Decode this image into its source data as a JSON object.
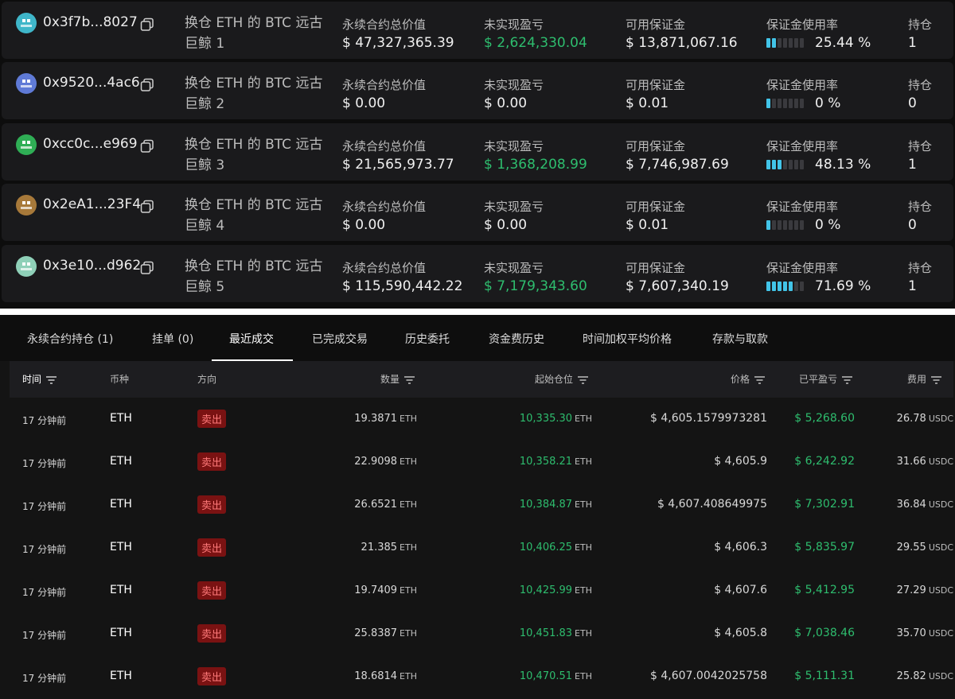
{
  "labels": {
    "perp_value": "永续合约总价值",
    "unrealized_pnl": "未实现盈亏",
    "available_margin": "可用保证金",
    "margin_usage": "保证金使用率",
    "positions": "持仓"
  },
  "wallets": [
    {
      "address": "0x3f7b...8027",
      "tag_line1": "换仓 ETH 的 BTC 远古",
      "tag_line2": "巨鲸 1",
      "perp_value": "$ 47,327,365.39",
      "unrealized_pnl": "$ 2,624,330.04",
      "pnl_positive": true,
      "available_margin": "$ 13,871,067.16",
      "margin_usage": "25.44 %",
      "margin_usage_fraction": 0.2544,
      "positions": "1",
      "avatar_color": "#3fb6c9"
    },
    {
      "address": "0x9520...4ac6",
      "tag_line1": "换仓 ETH 的 BTC 远古",
      "tag_line2": "巨鲸 2",
      "perp_value": "$ 0.00",
      "unrealized_pnl": "$ 0.00",
      "pnl_positive": false,
      "available_margin": "$ 0.01",
      "margin_usage": "0 %",
      "margin_usage_fraction": 0,
      "positions": "0",
      "avatar_color": "#5f7ad6"
    },
    {
      "address": "0xcc0c...e969",
      "tag_line1": "换仓 ETH 的 BTC 远古",
      "tag_line2": "巨鲸 3",
      "perp_value": "$ 21,565,973.77",
      "unrealized_pnl": "$ 1,368,208.99",
      "pnl_positive": true,
      "available_margin": "$ 7,746,987.69",
      "margin_usage": "48.13 %",
      "margin_usage_fraction": 0.4813,
      "positions": "1",
      "avatar_color": "#2fae55"
    },
    {
      "address": "0x2eA1...23F4",
      "tag_line1": "换仓 ETH 的 BTC 远古",
      "tag_line2": "巨鲸 4",
      "perp_value": "$ 0.00",
      "unrealized_pnl": "$ 0.00",
      "pnl_positive": false,
      "available_margin": "$ 0.01",
      "margin_usage": "0 %",
      "margin_usage_fraction": 0,
      "positions": "0",
      "avatar_color": "#a7793a"
    },
    {
      "address": "0x3e10...d962",
      "tag_line1": "换仓 ETH 的 BTC 远古",
      "tag_line2": "巨鲸 5",
      "perp_value": "$ 115,590,442.22",
      "unrealized_pnl": "$ 7,179,343.60",
      "pnl_positive": true,
      "available_margin": "$ 7,607,340.19",
      "margin_usage": "71.69 %",
      "margin_usage_fraction": 0.7169,
      "positions": "1",
      "avatar_color": "#8fd0b8"
    }
  ],
  "tabs": [
    {
      "label": "永续合约持仓 (1)",
      "active": false
    },
    {
      "label": "挂单 (0)",
      "active": false
    },
    {
      "label": "最近成交",
      "active": true
    },
    {
      "label": "已完成交易",
      "active": false
    },
    {
      "label": "历史委托",
      "active": false
    },
    {
      "label": "资金费历史",
      "active": false
    },
    {
      "label": "时间加权平均价格",
      "active": false
    },
    {
      "label": "存款与取款",
      "active": false
    }
  ],
  "trade_headers": {
    "time": "时间",
    "coin": "币种",
    "direction": "方向",
    "size": "数量",
    "start_position": "起始仓位",
    "price": "价格",
    "closed_pnl": "已平盈亏",
    "fee": "费用"
  },
  "trades": [
    {
      "time": "17 分钟前",
      "coin": "ETH",
      "direction": "卖出",
      "size": "19.3871",
      "size_unit": "ETH",
      "start_position": "10,335.30",
      "start_unit": "ETH",
      "price": "$ 4,605.1579973281",
      "closed_pnl": "$ 5,268.60",
      "fee": "26.78",
      "fee_unit": "USDC"
    },
    {
      "time": "17 分钟前",
      "coin": "ETH",
      "direction": "卖出",
      "size": "22.9098",
      "size_unit": "ETH",
      "start_position": "10,358.21",
      "start_unit": "ETH",
      "price": "$ 4,605.9",
      "closed_pnl": "$ 6,242.92",
      "fee": "31.66",
      "fee_unit": "USDC"
    },
    {
      "time": "17 分钟前",
      "coin": "ETH",
      "direction": "卖出",
      "size": "26.6521",
      "size_unit": "ETH",
      "start_position": "10,384.87",
      "start_unit": "ETH",
      "price": "$ 4,607.408649975",
      "closed_pnl": "$ 7,302.91",
      "fee": "36.84",
      "fee_unit": "USDC"
    },
    {
      "time": "17 分钟前",
      "coin": "ETH",
      "direction": "卖出",
      "size": "21.385",
      "size_unit": "ETH",
      "start_position": "10,406.25",
      "start_unit": "ETH",
      "price": "$ 4,606.3",
      "closed_pnl": "$ 5,835.97",
      "fee": "29.55",
      "fee_unit": "USDC"
    },
    {
      "time": "17 分钟前",
      "coin": "ETH",
      "direction": "卖出",
      "size": "19.7409",
      "size_unit": "ETH",
      "start_position": "10,425.99",
      "start_unit": "ETH",
      "price": "$ 4,607.6",
      "closed_pnl": "$ 5,412.95",
      "fee": "27.29",
      "fee_unit": "USDC"
    },
    {
      "time": "17 分钟前",
      "coin": "ETH",
      "direction": "卖出",
      "size": "25.8387",
      "size_unit": "ETH",
      "start_position": "10,451.83",
      "start_unit": "ETH",
      "price": "$ 4,605.8",
      "closed_pnl": "$ 7,038.46",
      "fee": "35.70",
      "fee_unit": "USDC"
    },
    {
      "time": "17 分钟前",
      "coin": "ETH",
      "direction": "卖出",
      "size": "18.6814",
      "size_unit": "ETH",
      "start_position": "10,470.51",
      "start_unit": "ETH",
      "price": "$ 4,607.0042025758",
      "closed_pnl": "$ 5,111.31",
      "fee": "25.82",
      "fee_unit": "USDC"
    }
  ],
  "colors": {
    "positive": "#2ebd6e",
    "sell_bg": "#7a1212",
    "sell_text": "#ff7a7a",
    "gauge_on": "#42c4e8"
  }
}
